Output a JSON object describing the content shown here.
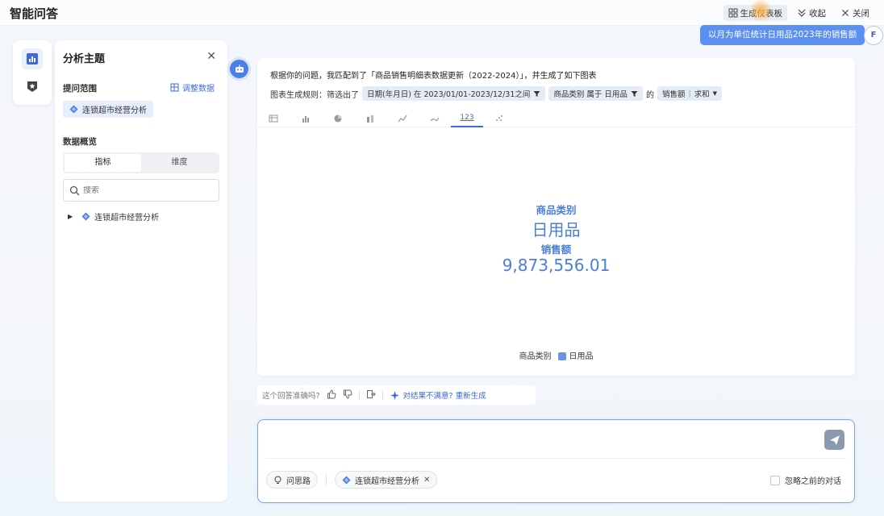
{
  "app": {
    "title": "智能问答"
  },
  "header": {
    "generate_dashboard": "生成仪表板",
    "collapse": "收起",
    "close": "关闭",
    "tooltip": "以月为单位统计日用品2023年的销售额",
    "user_initial": "F"
  },
  "rail": {
    "items": [
      "analysis-icon",
      "favorites-icon"
    ]
  },
  "panel": {
    "title": "分析主题",
    "scope_label": "提问范围",
    "adjust_data": "调整数据",
    "scope_tag": "连锁超市经营分析",
    "overview_label": "数据概览",
    "segments": [
      "指标",
      "维度"
    ],
    "search_placeholder": "搜索",
    "tree_item": "连锁超市经营分析"
  },
  "answer": {
    "intro": "根据你的问题，我匹配到了「商品销售明细表数据更新（2022-2024）」，并生成了如下图表",
    "rule_label": "图表生成规则：筛选出了",
    "filters": [
      "日期(年月日) 在 2023/01/01-2023/12/31之间",
      "商品类别 属于 日用品"
    ],
    "of": "的",
    "measure": "销售额",
    "agg": "求和",
    "active_tab_label": "123"
  },
  "chart_data": {
    "type": "table",
    "kpi": [
      {
        "label": "商品类别",
        "value": "日用品"
      },
      {
        "label": "销售额",
        "value": "9,873,556.01"
      }
    ],
    "legend_title": "商品类别",
    "legend": [
      {
        "name": "日用品",
        "color": "#6e93e4"
      }
    ]
  },
  "feedback": {
    "question": "这个回答准确吗?",
    "retry": "对结果不满意? 重新生成"
  },
  "input": {
    "value": "",
    "chip_thought": "问思路",
    "chip_scope": "连锁超市经营分析",
    "ignore_previous": "忽略之前的对话"
  }
}
